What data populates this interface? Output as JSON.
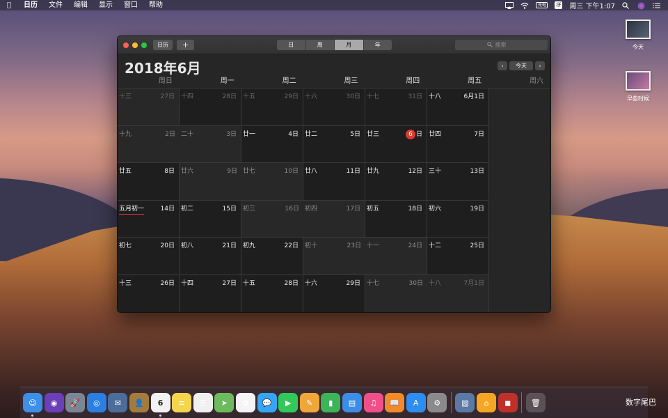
{
  "menubar": {
    "apple": "",
    "items": [
      "日历",
      "文件",
      "编辑",
      "显示",
      "窗口",
      "帮助"
    ],
    "battery": "充电",
    "ime": "拼",
    "clock": "周三 下午1:07"
  },
  "desktop": {
    "icons": [
      {
        "label": "今天"
      },
      {
        "label": "早些时候"
      }
    ]
  },
  "window": {
    "toolbar": {
      "calendars_label": "日历",
      "add_label": "+",
      "views": [
        "日",
        "周",
        "月",
        "年"
      ],
      "active_view": "月",
      "search_placeholder": "搜索"
    },
    "month_title": "2018年6月",
    "nav": {
      "prev": "‹",
      "today": "今天",
      "next": "›"
    },
    "weekdays": [
      "周日",
      "周一",
      "周二",
      "周三",
      "周四",
      "周五",
      "周六"
    ],
    "weeks": [
      [
        {
          "lunar": "十三",
          "date": "27日",
          "type": "other"
        },
        {
          "lunar": "十四",
          "date": "28日",
          "type": "other"
        },
        {
          "lunar": "十五",
          "date": "29日",
          "type": "other"
        },
        {
          "lunar": "十六",
          "date": "30日",
          "type": "other"
        },
        {
          "lunar": "十七",
          "date": "31日",
          "type": "other"
        },
        {
          "lunar": "十八",
          "date": "6月1日",
          "type": "cur"
        },
        {
          "lunar": "十九",
          "date": "2日",
          "type": "wk"
        }
      ],
      [
        {
          "lunar": "二十",
          "date": "3日",
          "type": "wk"
        },
        {
          "lunar": "廿一",
          "date": "4日",
          "type": "cur"
        },
        {
          "lunar": "廿二",
          "date": "5日",
          "type": "cur"
        },
        {
          "lunar": "廿三",
          "date": "6",
          "type": "today",
          "suffix": "日"
        },
        {
          "lunar": "廿四",
          "date": "7日",
          "type": "cur"
        },
        {
          "lunar": "廿五",
          "date": "8日",
          "type": "cur"
        },
        {
          "lunar": "廿六",
          "date": "9日",
          "type": "wk"
        }
      ],
      [
        {
          "lunar": "廿七",
          "date": "10日",
          "type": "wk"
        },
        {
          "lunar": "廿八",
          "date": "11日",
          "type": "cur"
        },
        {
          "lunar": "廿九",
          "date": "12日",
          "type": "cur"
        },
        {
          "lunar": "三十",
          "date": "13日",
          "type": "cur"
        },
        {
          "lunar": "五月初一",
          "date": "14日",
          "type": "cur",
          "special": true
        },
        {
          "lunar": "初二",
          "date": "15日",
          "type": "cur"
        },
        {
          "lunar": "初三",
          "date": "16日",
          "type": "wk"
        }
      ],
      [
        {
          "lunar": "初四",
          "date": "17日",
          "type": "wk"
        },
        {
          "lunar": "初五",
          "date": "18日",
          "type": "cur"
        },
        {
          "lunar": "初六",
          "date": "19日",
          "type": "cur"
        },
        {
          "lunar": "初七",
          "date": "20日",
          "type": "cur"
        },
        {
          "lunar": "初八",
          "date": "21日",
          "type": "cur"
        },
        {
          "lunar": "初九",
          "date": "22日",
          "type": "cur"
        },
        {
          "lunar": "初十",
          "date": "23日",
          "type": "wk"
        }
      ],
      [
        {
          "lunar": "十一",
          "date": "24日",
          "type": "wk"
        },
        {
          "lunar": "十二",
          "date": "25日",
          "type": "cur"
        },
        {
          "lunar": "十三",
          "date": "26日",
          "type": "cur"
        },
        {
          "lunar": "十四",
          "date": "27日",
          "type": "cur"
        },
        {
          "lunar": "十五",
          "date": "28日",
          "type": "cur"
        },
        {
          "lunar": "十六",
          "date": "29日",
          "type": "cur"
        },
        {
          "lunar": "十七",
          "date": "30日",
          "type": "wk"
        }
      ],
      [
        {
          "lunar": "十八",
          "date": "7月1日",
          "type": "other"
        },
        {
          "lunar": "十九",
          "date": "2日",
          "type": "other"
        },
        {
          "lunar": "二十",
          "date": "3日",
          "type": "other"
        },
        {
          "lunar": "廿一",
          "date": "4日",
          "type": "other"
        },
        {
          "lunar": "廿二",
          "date": "5日",
          "type": "other"
        },
        {
          "lunar": "廿三",
          "date": "6日",
          "type": "other"
        },
        {
          "lunar": "廿四",
          "date": "7日",
          "type": "other"
        }
      ]
    ]
  },
  "dock": {
    "apps": [
      {
        "name": "finder",
        "color": "#3d8fe8",
        "glyph": "☺",
        "running": true
      },
      {
        "name": "siri",
        "color": "#6b3fb8",
        "glyph": "◉"
      },
      {
        "name": "launchpad",
        "color": "#7a8595",
        "glyph": "🚀"
      },
      {
        "name": "safari",
        "color": "#2a7fe0",
        "glyph": "◎"
      },
      {
        "name": "mail-stamp",
        "color": "#4c6c9a",
        "glyph": "✉"
      },
      {
        "name": "contacts",
        "color": "#a57b3b",
        "glyph": "👤"
      },
      {
        "name": "calendar",
        "color": "#f2f2f2",
        "glyph": "6",
        "running": true
      },
      {
        "name": "notes",
        "color": "#f5d54c",
        "glyph": "≡"
      },
      {
        "name": "reminders",
        "color": "#f0f0f0",
        "glyph": "☰"
      },
      {
        "name": "maps",
        "color": "#6dbb5c",
        "glyph": "➤"
      },
      {
        "name": "photos",
        "color": "#f4f4f4",
        "glyph": "✿"
      },
      {
        "name": "messages",
        "color": "#35a6f5",
        "glyph": "💬"
      },
      {
        "name": "facetime",
        "color": "#32c85a",
        "glyph": "▶"
      },
      {
        "name": "pages",
        "color": "#f0a73a",
        "glyph": "✎"
      },
      {
        "name": "numbers",
        "color": "#3db45a",
        "glyph": "▮"
      },
      {
        "name": "keynote",
        "color": "#3c8de8",
        "glyph": "▤"
      },
      {
        "name": "itunes",
        "color": "#f04f8a",
        "glyph": "♫"
      },
      {
        "name": "ibooks",
        "color": "#f28a2a",
        "glyph": "📖"
      },
      {
        "name": "app-store",
        "color": "#2d8df0",
        "glyph": "A"
      },
      {
        "name": "system-preferences",
        "color": "#8a8a8a",
        "glyph": "⚙"
      }
    ],
    "extras": [
      {
        "name": "preview",
        "color": "#5a7aa5",
        "glyph": "▧"
      },
      {
        "name": "home",
        "color": "#f5a623",
        "glyph": "⌂"
      },
      {
        "name": "photo-booth",
        "color": "#c0302a",
        "glyph": "◼"
      }
    ],
    "trash_glyph": "🗑",
    "watermark": "数字尾巴"
  }
}
